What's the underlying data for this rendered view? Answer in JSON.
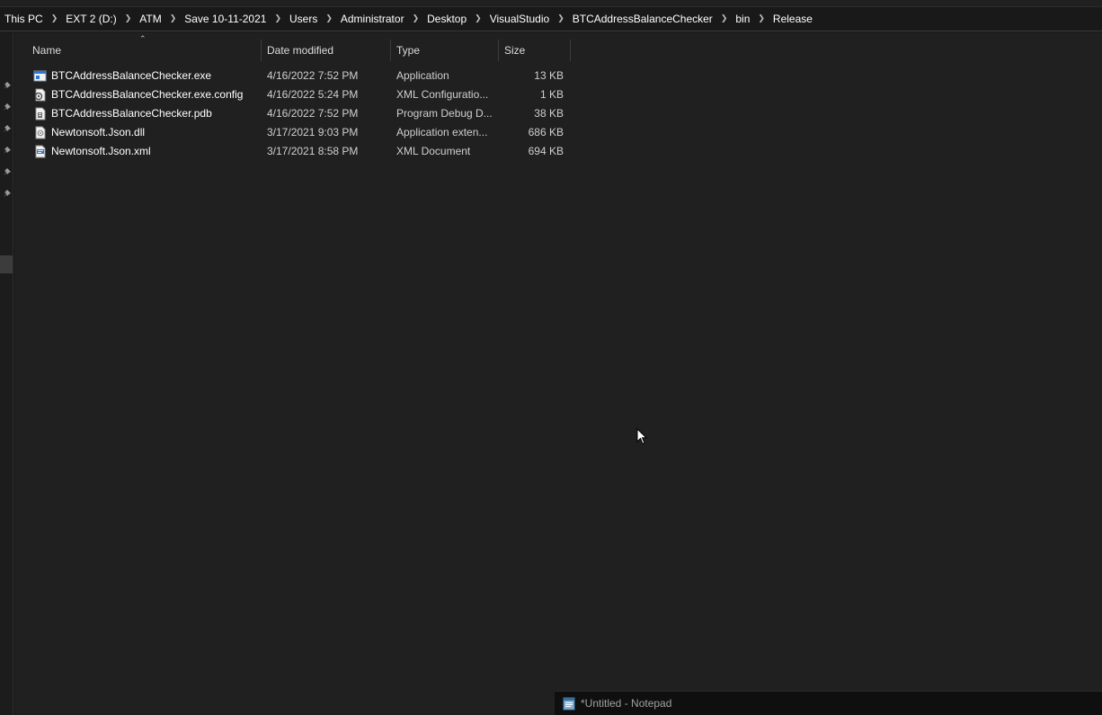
{
  "breadcrumb": [
    "This PC",
    "EXT 2 (D:)",
    "ATM",
    "Save 10-11-2021",
    "Users",
    "Administrator",
    "Desktop",
    "VisualStudio",
    "BTCAddressBalanceChecker",
    "bin",
    "Release"
  ],
  "columns": {
    "name": "Name",
    "date": "Date modified",
    "type": "Type",
    "size": "Size"
  },
  "files": [
    {
      "name": "BTCAddressBalanceChecker.exe",
      "date": "4/16/2022 7:52 PM",
      "type": "Application",
      "size": "13 KB",
      "icon": "application-icon"
    },
    {
      "name": "BTCAddressBalanceChecker.exe.config",
      "date": "4/16/2022 5:24 PM",
      "type": "XML Configuratio...",
      "size": "1 KB",
      "icon": "config-file-icon"
    },
    {
      "name": "BTCAddressBalanceChecker.pdb",
      "date": "4/16/2022 7:52 PM",
      "type": "Program Debug D...",
      "size": "38 KB",
      "icon": "debug-file-icon"
    },
    {
      "name": "Newtonsoft.Json.dll",
      "date": "3/17/2021 9:03 PM",
      "type": "Application exten...",
      "size": "686 KB",
      "icon": "dll-file-icon"
    },
    {
      "name": "Newtonsoft.Json.xml",
      "date": "3/17/2021 8:58 PM",
      "type": "XML Document",
      "size": "694 KB",
      "icon": "xml-file-icon"
    }
  ],
  "taskbar": {
    "notepad_title": "*Untitled - Notepad"
  },
  "colors": {
    "background": "#202020",
    "address_bar": "#191919",
    "text": "#ffffff",
    "secondary_text": "#cfcfcf"
  }
}
